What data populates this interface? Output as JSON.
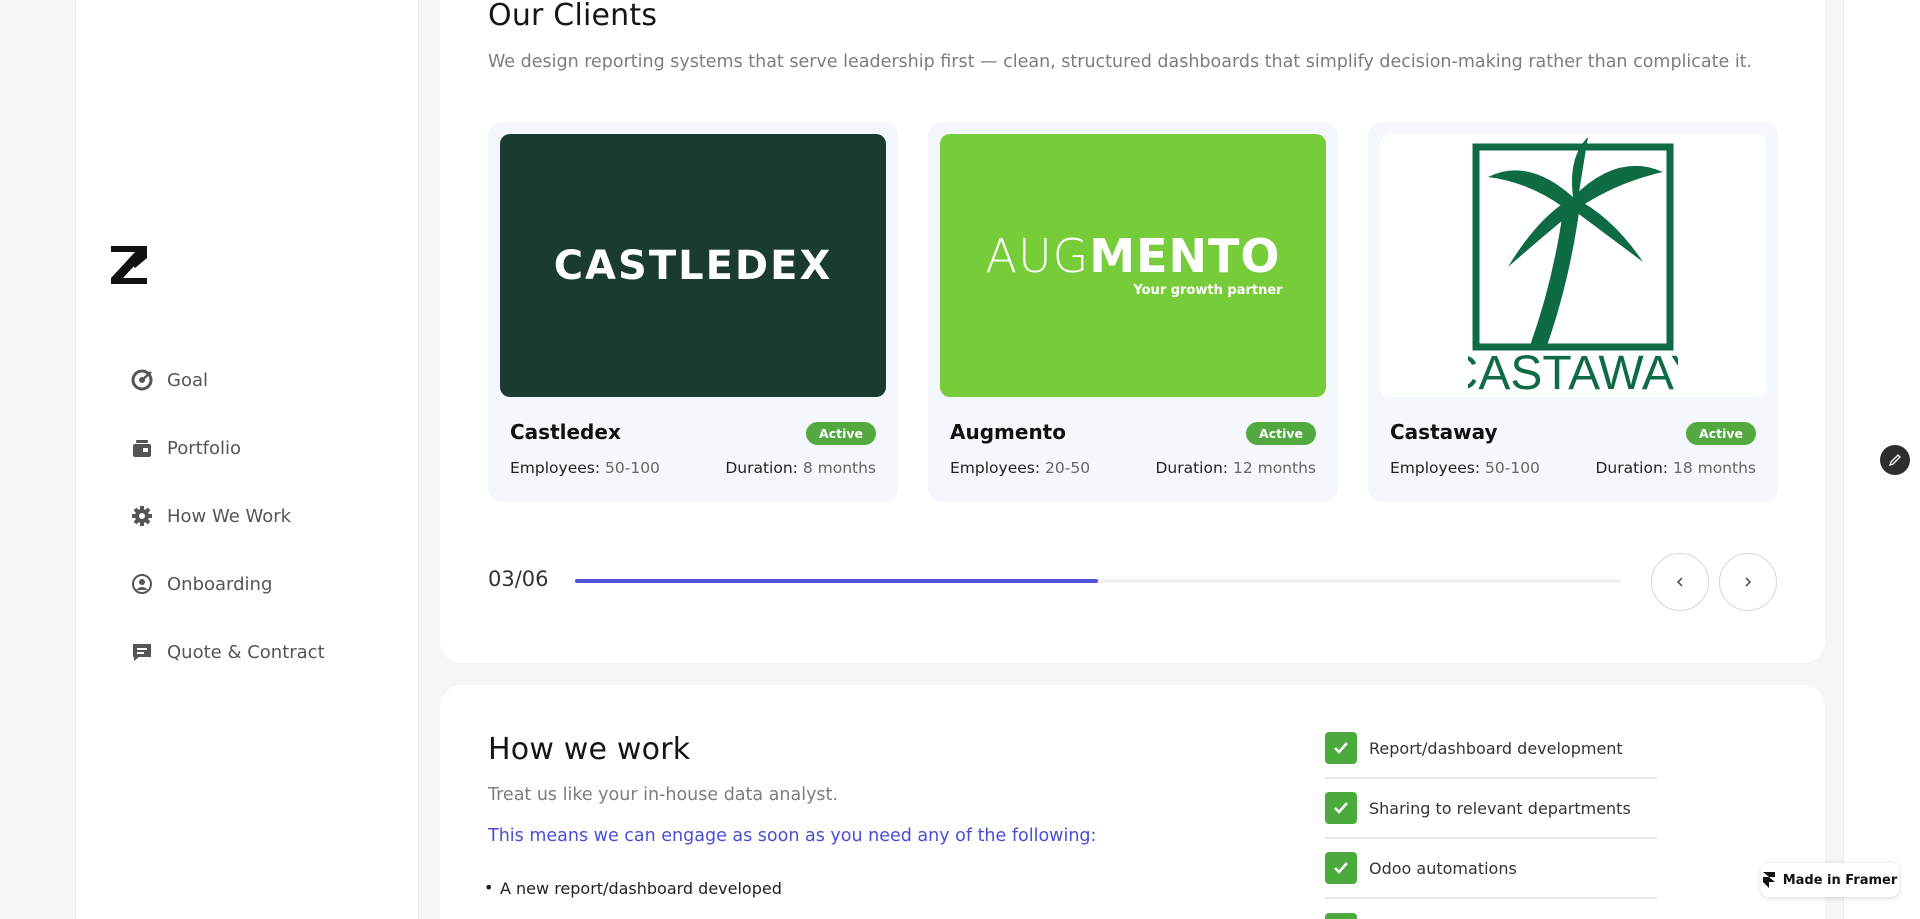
{
  "sidebar": {
    "logo_icon": "brand-z-logo",
    "items": [
      {
        "label": "Goal",
        "icon": "target-icon"
      },
      {
        "label": "Portfolio",
        "icon": "portfolio-icon"
      },
      {
        "label": "How We Work",
        "icon": "gear-icon"
      },
      {
        "label": "Onboarding",
        "icon": "user-circle-icon"
      },
      {
        "label": "Quote & Contract",
        "icon": "chat-icon"
      }
    ]
  },
  "clients_section": {
    "title": "Our Clients",
    "subtitle": "We design reporting systems that serve leadership first — clean, structured dashboards that simplify decision-making rather than complicate it.",
    "cards": [
      {
        "name": "Castledex",
        "status": "Active",
        "employees_label": "Employees:",
        "employees": "50-100",
        "duration_label": "Duration:",
        "duration": "8 months",
        "logo_text": "CASTLEDEX",
        "logo_bg": "#1b3b30"
      },
      {
        "name": "Augmento",
        "status": "Active",
        "employees_label": "Employees:",
        "employees": "20-50",
        "duration_label": "Duration:",
        "duration": "12 months",
        "logo_text_light": "AUG",
        "logo_text_bold": "MENTO",
        "logo_tagline": "Your growth partner",
        "logo_bg": "#77cc3a"
      },
      {
        "name": "Castaway",
        "status": "Active",
        "employees_label": "Employees:",
        "employees": "50-100",
        "duration_label": "Duration:",
        "duration": "18 months",
        "logo_text": "CASTAWAY",
        "logo_bg": "#ffffff"
      }
    ],
    "pager": {
      "counter": "03/06",
      "progress": 0.5,
      "prev_icon": "chevron-left-icon",
      "next_icon": "chevron-right-icon"
    }
  },
  "work_section": {
    "title": "How we work",
    "subtitle": "Treat us like your in-house data analyst.",
    "highlight": "This means we can engage as soon as you need any of the following:",
    "bullets": [
      "A new report/dashboard developed"
    ],
    "checklist": [
      "Report/dashboard development",
      "Sharing to relevant departments",
      "Odoo automations"
    ]
  },
  "framer_badge": {
    "label": "Made in Framer"
  },
  "colors": {
    "accent": "#4f52d6",
    "active_badge": "#52a93f",
    "check": "#4aab3c"
  }
}
